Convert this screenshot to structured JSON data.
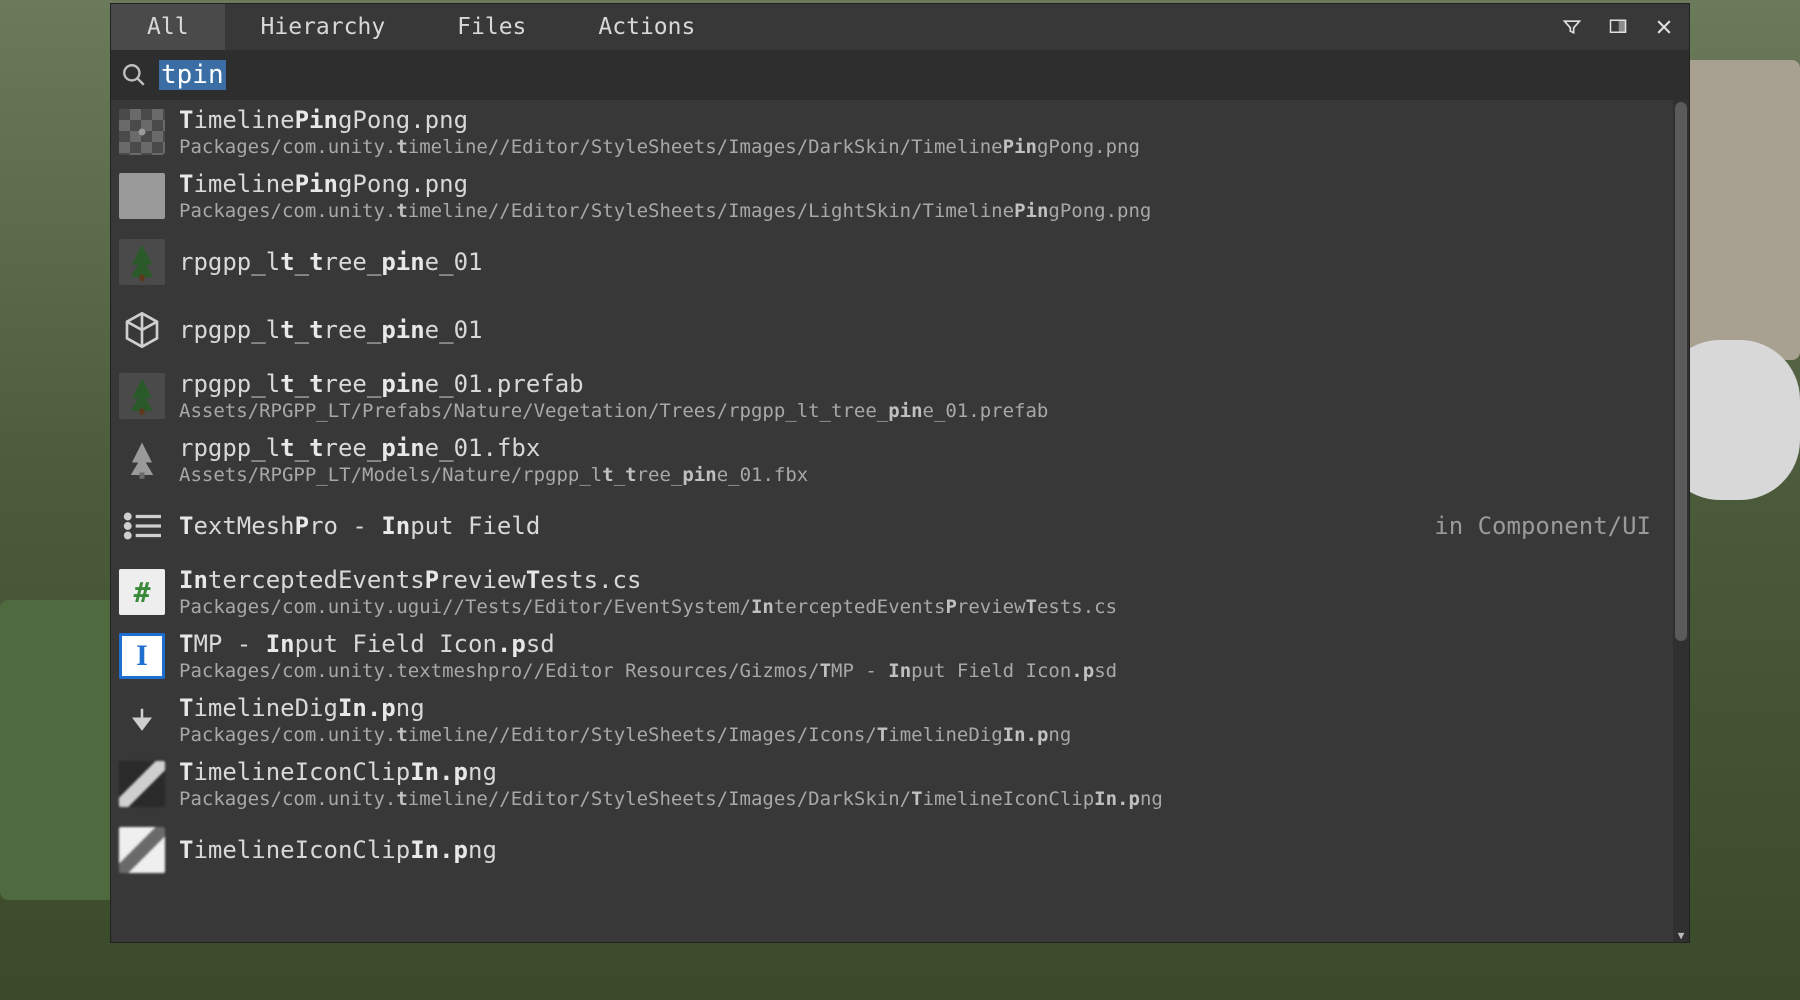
{
  "tabs": {
    "all": "All",
    "hierarchy": "Hierarchy",
    "files": "Files",
    "actions": "Actions",
    "active": "all"
  },
  "search": {
    "query": "tpin"
  },
  "results": [
    {
      "icon": "dark-checker",
      "titleParts": [
        "",
        "T",
        "imeline",
        "Pin",
        "gPong.png"
      ],
      "pathParts": [
        "Packages/com.unity.",
        "t",
        "imeline//Editor/StyleSheets/Images/DarkSkin/Timeline",
        "Pin",
        "gPong.png"
      ]
    },
    {
      "icon": "light-checker",
      "titleParts": [
        "",
        "T",
        "imeline",
        "Pin",
        "gPong.png"
      ],
      "pathParts": [
        "Packages/com.unity.",
        "t",
        "imeline//Editor/StyleSheets/Images/LightSkin/Timeline",
        "Pin",
        "gPong.png"
      ]
    },
    {
      "icon": "tree-prefab",
      "single": true,
      "titleParts": [
        "rpgpp_l",
        "t",
        "_",
        "t",
        "ree_",
        "pin",
        "e_01"
      ]
    },
    {
      "icon": "cube-outline",
      "single": true,
      "titleParts": [
        "rpgpp_l",
        "t",
        "_",
        "t",
        "ree_",
        "pin",
        "e_01"
      ]
    },
    {
      "icon": "tree-prefab",
      "titleParts": [
        "rpgpp_l",
        "t",
        "_",
        "t",
        "ree_",
        "pin",
        "e_01.prefab"
      ],
      "pathParts": [
        "Assets/RPGPP_LT/Prefabs/Nature/Vegetation/Trees/rpgpp_lt_tree_",
        "pin",
        "e_01.prefab"
      ]
    },
    {
      "icon": "tree-gray",
      "titleParts": [
        "rpgpp_l",
        "t",
        "_",
        "t",
        "ree_",
        "pin",
        "e_01.fbx"
      ],
      "pathParts": [
        "Assets/RPGPP_LT/Models/Nature/rpgpp_l",
        "t",
        "_",
        "t",
        "ree_",
        "pin",
        "e_01.fbx"
      ]
    },
    {
      "icon": "list-icon",
      "single": true,
      "titleParts": [
        "",
        "T",
        "extMesh",
        "P",
        "ro - ",
        "In",
        "put Field"
      ],
      "aside": "in Component/UI"
    },
    {
      "icon": "csharp",
      "titleParts": [
        "",
        "In",
        "terceptedEvents",
        "P",
        "review",
        "T",
        "ests.cs"
      ],
      "pathParts": [
        "Packages/com.unity.ugui//Tests/Editor/EventSystem/",
        "In",
        "terceptedEvents",
        "P",
        "review",
        "T",
        "ests.cs"
      ]
    },
    {
      "icon": "tmp-i",
      "titleParts": [
        "",
        "T",
        "MP - ",
        "In",
        "put Field Icon",
        ".p",
        "sd"
      ],
      "pathParts": [
        "Packages/com.unity.textmeshpro//Editor Resources/Gizmos/",
        "T",
        "MP - ",
        "In",
        "put Field Icon",
        ".p",
        "sd"
      ]
    },
    {
      "icon": "arrow-down",
      "titleParts": [
        "",
        "T",
        "imelineDig",
        "In.p",
        "ng"
      ],
      "pathParts": [
        "Packages/com.unity.",
        "t",
        "imeline//Editor/StyleSheets/Images/Icons/",
        "T",
        "imelineDig",
        "In.p",
        "ng"
      ]
    },
    {
      "icon": "clip-dark",
      "titleParts": [
        "",
        "T",
        "imelineIconClip",
        "In.p",
        "ng"
      ],
      "pathParts": [
        "Packages/com.unity.",
        "t",
        "imeline//Editor/StyleSheets/Images/DarkSkin/",
        "T",
        "imelineIconClip",
        "In.p",
        "ng"
      ]
    },
    {
      "icon": "clip-light",
      "single": true,
      "titleParts": [
        "",
        "T",
        "imelineIconClip",
        "In.p",
        "ng"
      ]
    }
  ]
}
